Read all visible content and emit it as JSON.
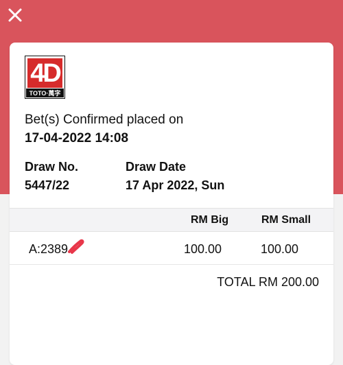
{
  "header": {
    "close_icon": "close-icon"
  },
  "logo": {
    "mark": "4D",
    "caption": "TOTO·萬字"
  },
  "confirmation": {
    "label": "Bet(s) Confirmed placed on",
    "datetime": "17-04-2022 14:08"
  },
  "draw": {
    "number_label": "Draw No.",
    "number_value": "5447/22",
    "date_label": "Draw Date",
    "date_value": "17 Apr 2022, Sun"
  },
  "table": {
    "headers": {
      "big": "RM Big",
      "small": "RM Small"
    },
    "rows": [
      {
        "number": "A:2389",
        "big": "100.00",
        "small": "100.00"
      }
    ]
  },
  "total": "TOTAL RM 200.00",
  "colors": {
    "header_red": "#d9545c",
    "logo_red": "#d62b2b",
    "redaction_mark": "#e8374a"
  }
}
